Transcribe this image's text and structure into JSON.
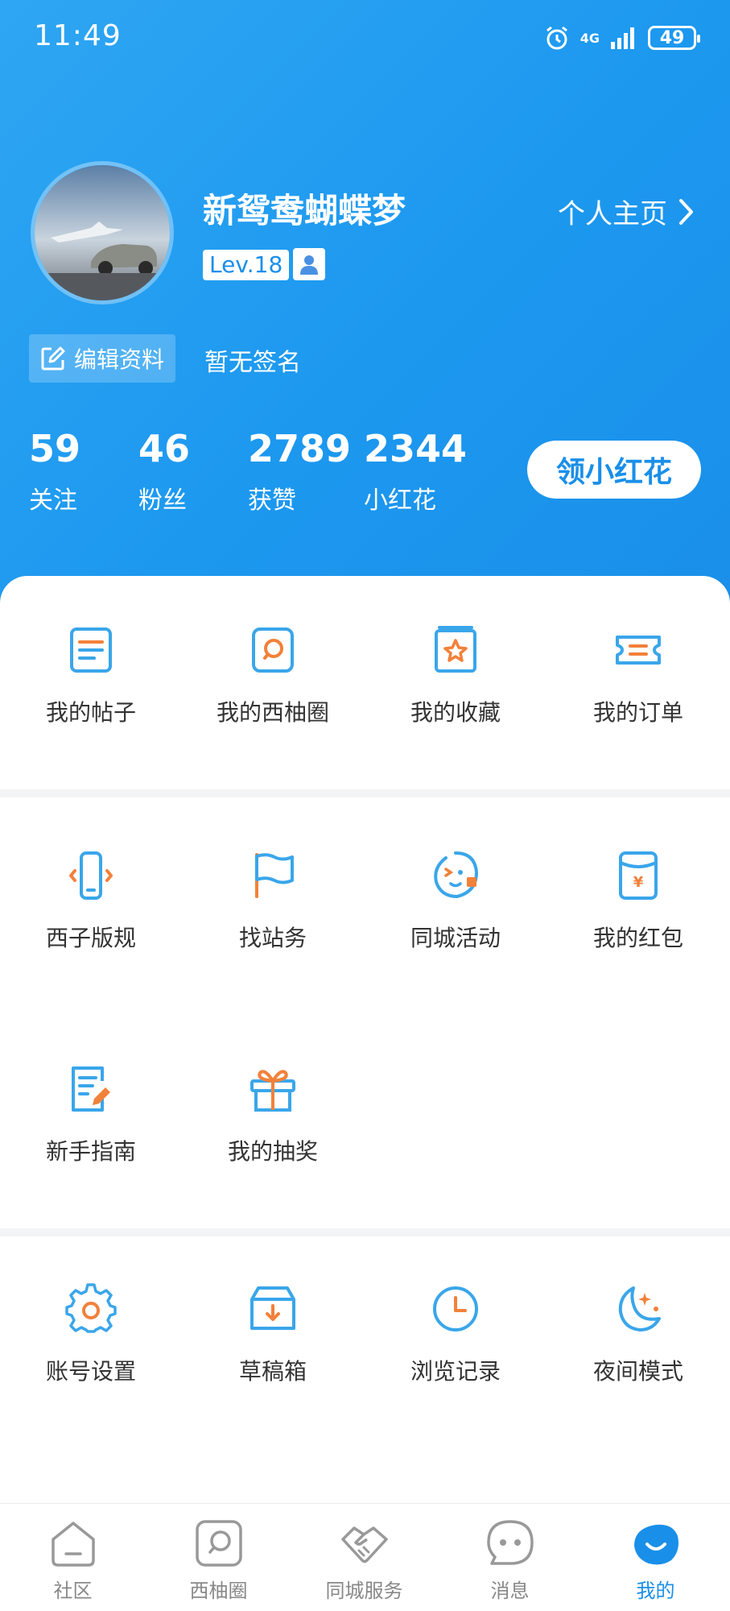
{
  "status_bar": {
    "time": "11:49",
    "battery": "49",
    "network": "4G"
  },
  "profile": {
    "username": "新鸳鸯蝴蝶梦",
    "level": "Lev.18",
    "profile_link": "个人主页",
    "edit_label": "编辑资料",
    "signature": "暂无签名"
  },
  "stats": [
    {
      "value": "59",
      "label": "关注"
    },
    {
      "value": "46",
      "label": "粉丝"
    },
    {
      "value": "2789",
      "label": "获赞"
    },
    {
      "value": "2344",
      "label": "小红花"
    }
  ],
  "flower_button": "领小红花",
  "section1": [
    {
      "label": "我的帖子",
      "icon": "post-icon"
    },
    {
      "label": "我的西柚圈",
      "icon": "circle-icon"
    },
    {
      "label": "我的收藏",
      "icon": "star-icon"
    },
    {
      "label": "我的订单",
      "icon": "ticket-icon"
    }
  ],
  "section2": [
    {
      "label": "西子版规",
      "icon": "phone-icon"
    },
    {
      "label": "找站务",
      "icon": "flag-icon"
    },
    {
      "label": "同城活动",
      "icon": "activity-icon"
    },
    {
      "label": "我的红包",
      "icon": "red-packet-icon"
    },
    {
      "label": "新手指南",
      "icon": "guide-icon"
    },
    {
      "label": "我的抽奖",
      "icon": "gift-icon"
    }
  ],
  "section3": [
    {
      "label": "账号设置",
      "icon": "gear-icon"
    },
    {
      "label": "草稿箱",
      "icon": "drafts-icon"
    },
    {
      "label": "浏览记录",
      "icon": "clock-icon"
    },
    {
      "label": "夜间模式",
      "icon": "moon-icon"
    }
  ],
  "tabbar": [
    {
      "label": "社区",
      "icon": "home-icon"
    },
    {
      "label": "西柚圈",
      "icon": "circle-icon"
    },
    {
      "label": "同城服务",
      "icon": "handshake-icon"
    },
    {
      "label": "消息",
      "icon": "message-icon"
    },
    {
      "label": "我的",
      "icon": "me-icon"
    }
  ],
  "colors": {
    "primary": "#1a8fe9",
    "accent_orange": "#f2813a",
    "icon_blue": "#3aa6ea"
  }
}
